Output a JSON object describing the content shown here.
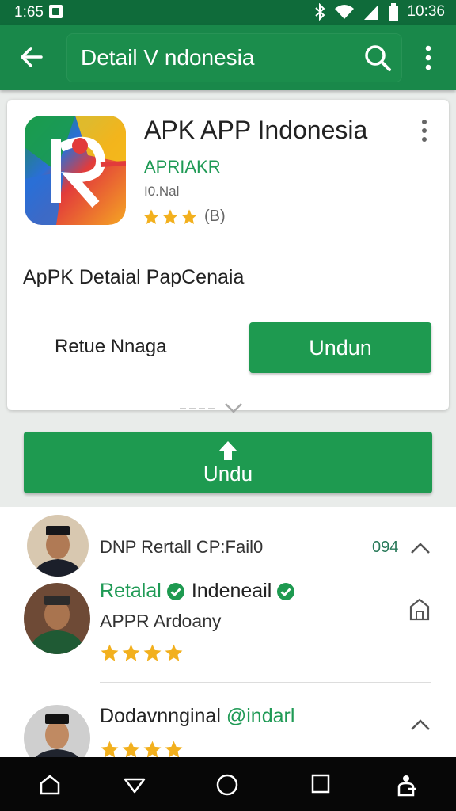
{
  "status_bar": {
    "time": "1:65",
    "clock": "10:36",
    "icons": [
      "notification-icon",
      "bluetooth-icon",
      "wifi-icon",
      "signal-icon",
      "battery-icon"
    ]
  },
  "app_bar": {
    "title": "Detail V ndonesia",
    "icons": [
      "back-arrow-icon",
      "search-icon",
      "more-vert-icon"
    ]
  },
  "app": {
    "name": "APK APP Indonesia",
    "developer": "APRIAKR",
    "meta": "I0.Nal",
    "rating_stars": 3,
    "rating_count": "(B)",
    "description": "ApPK Detaial PapCenaia",
    "secondary_label": "Retue Nnaga",
    "install_button": "Undun"
  },
  "download_button": "Undu",
  "reviews": {
    "first": {
      "title": "DNP Rertall CP:Fail0",
      "number": "094"
    },
    "second": {
      "name_part1": "Retalal",
      "name_part2": "Indeneail",
      "subtitle": "APPR Ardoany",
      "stars": 4
    },
    "third": {
      "name_part1": "Dodavnnginal",
      "name_part2": "@indarl",
      "stars": 4
    }
  },
  "nav_bar": {
    "icons": [
      "home-icon",
      "back-triangle-icon",
      "circle-home-icon",
      "recents-icon",
      "profile-icon"
    ]
  },
  "colors": {
    "status_bar": "#0f6b3a",
    "app_bar": "#19884a",
    "accent_green": "#1e9a50",
    "star": "#f2b01e",
    "nav_bar": "#070707"
  }
}
